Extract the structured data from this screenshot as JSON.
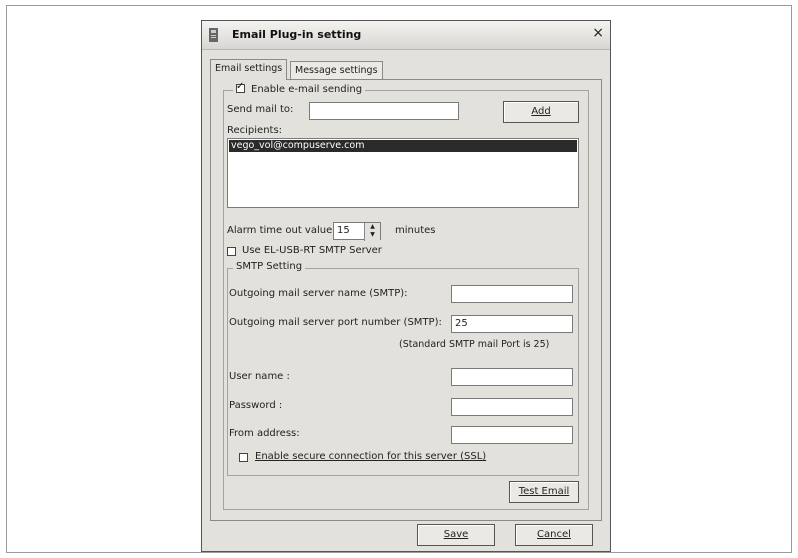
{
  "window": {
    "title": "Email Plug-in setting",
    "close_glyph": "×"
  },
  "tabs": [
    {
      "label": "Email settings"
    },
    {
      "label": "Message settings"
    }
  ],
  "email": {
    "enable_label": "Enable e-mail sending",
    "enable_checked": true,
    "send_to_label": "Send mail to:",
    "send_to_value": "",
    "add_label": "Add",
    "recipients_label": "Recipients:",
    "recipients": [
      "vego_vol@compuserve.com"
    ],
    "alarm_label": "Alarm time out value",
    "alarm_value": "15",
    "alarm_units": "minutes",
    "use_server_label": "Use EL-USB-RT SMTP Server",
    "use_server_checked": false
  },
  "smtp": {
    "legend": "SMTP Setting",
    "server_name_label": "Outgoing mail server name (SMTP):",
    "server_name_value": "",
    "port_label": "Outgoing mail server port number (SMTP):",
    "port_value": "25",
    "port_hint": "(Standard SMTP mail Port is 25)",
    "user_label": "User name :",
    "user_value": "",
    "password_label": "Password :",
    "password_value": "",
    "from_label": "From address:",
    "from_value": "",
    "ssl_label": "Enable secure connection for this server (SSL)",
    "ssl_checked": false,
    "test_label": "Test Email"
  },
  "footer": {
    "save_label": "Save",
    "cancel_label": "Cancel"
  }
}
